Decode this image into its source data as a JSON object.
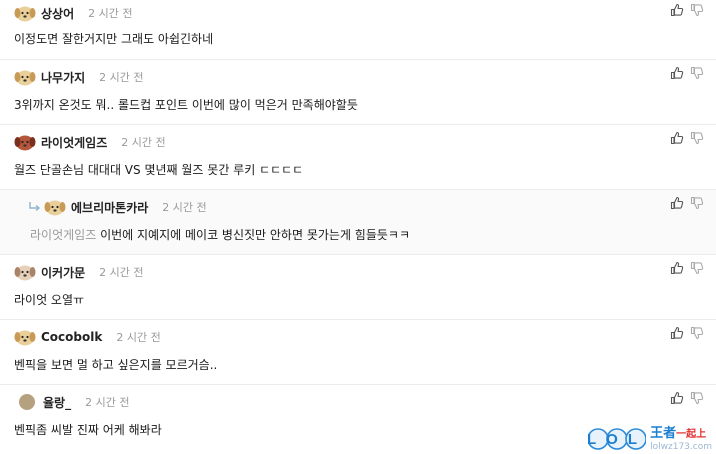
{
  "comments": [
    {
      "nick": "상상어",
      "time": "2 시간 전",
      "text": "이정도면 잘한거지만 그래도 아쉽긴하네"
    },
    {
      "nick": "나무가지",
      "time": "2 시간 전",
      "text": "3위까지 온것도 뭐.. 롤드컵 포인트 이번에 많이 먹은거 만족해야할듯"
    },
    {
      "nick": "라이엇게임즈",
      "time": "2 시간 전",
      "text": "월즈 단골손님 대대대 VS 몇년째 월즈 못간 루키 ㄷㄷㄷㄷ"
    },
    {
      "nick": "에브리마톤카라",
      "time": "2 시간 전",
      "reply_to": "라이엇게임즈",
      "text": "이번에 지예지에 메이코 병신짓만 안하면 못가는게 힘들듯ㅋㅋ"
    },
    {
      "nick": "이커가문",
      "time": "2 시간 전",
      "text": "라이엇 오열ㅠ"
    },
    {
      "nick": "Cocobolk",
      "time": "2 시간 전",
      "text": "벤픽을 보면 멀 하고 싶은지를 모르거슴.."
    },
    {
      "nick": "율랑_",
      "time": "2 시간 전",
      "text": "벤픽좀 씨발 진짜 어케 해봐라"
    }
  ],
  "watermark": {
    "logo_text": "LOL",
    "title": "王者",
    "title_tail": "一起上",
    "url": "lolwz173.com"
  },
  "icons": {
    "upvote": "thumbs-up-icon",
    "downvote": "thumbs-down-icon",
    "reply": "reply-arrow-icon"
  },
  "colors": {
    "brand_blue": "#1a7fd0",
    "divider": "#ececec",
    "time_gray": "#9a9a9a"
  }
}
